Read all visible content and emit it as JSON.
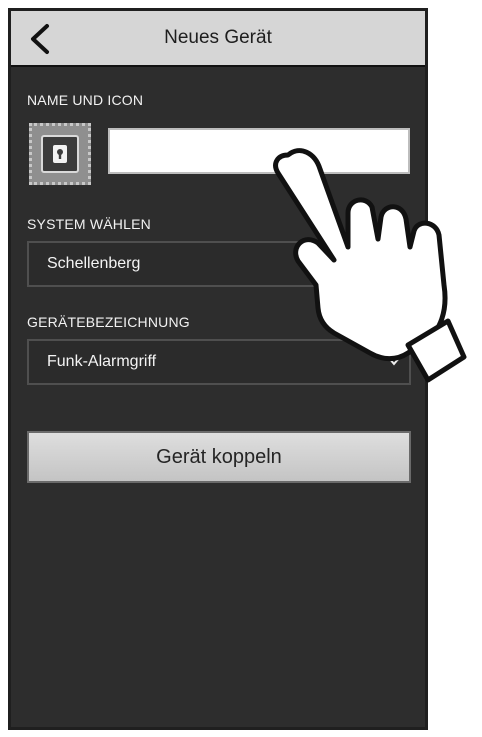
{
  "header": {
    "title": "Neues Gerät",
    "back_icon": "chevron-left-icon"
  },
  "name_section": {
    "label": "NAME UND ICON",
    "device_icon": "lock-icon",
    "name_input_value": ""
  },
  "system_section": {
    "label": "SYSTEM WÄHLEN",
    "selected_value": "Schellenberg"
  },
  "device_type_section": {
    "label": "GERÄTEBEZEICHNUNG",
    "selected_value": "Funk-Alarmgriff",
    "arrow_icon": "chevron-down-icon"
  },
  "actions": {
    "pair_button_label": "Gerät koppeln"
  },
  "overlay": {
    "hand_icon": "pointing-hand-icon"
  },
  "colors": {
    "background": "#2d2d2d",
    "header_background": "#d6d6d6",
    "button_background": "#d0d0d0",
    "input_background": "#ffffff"
  }
}
